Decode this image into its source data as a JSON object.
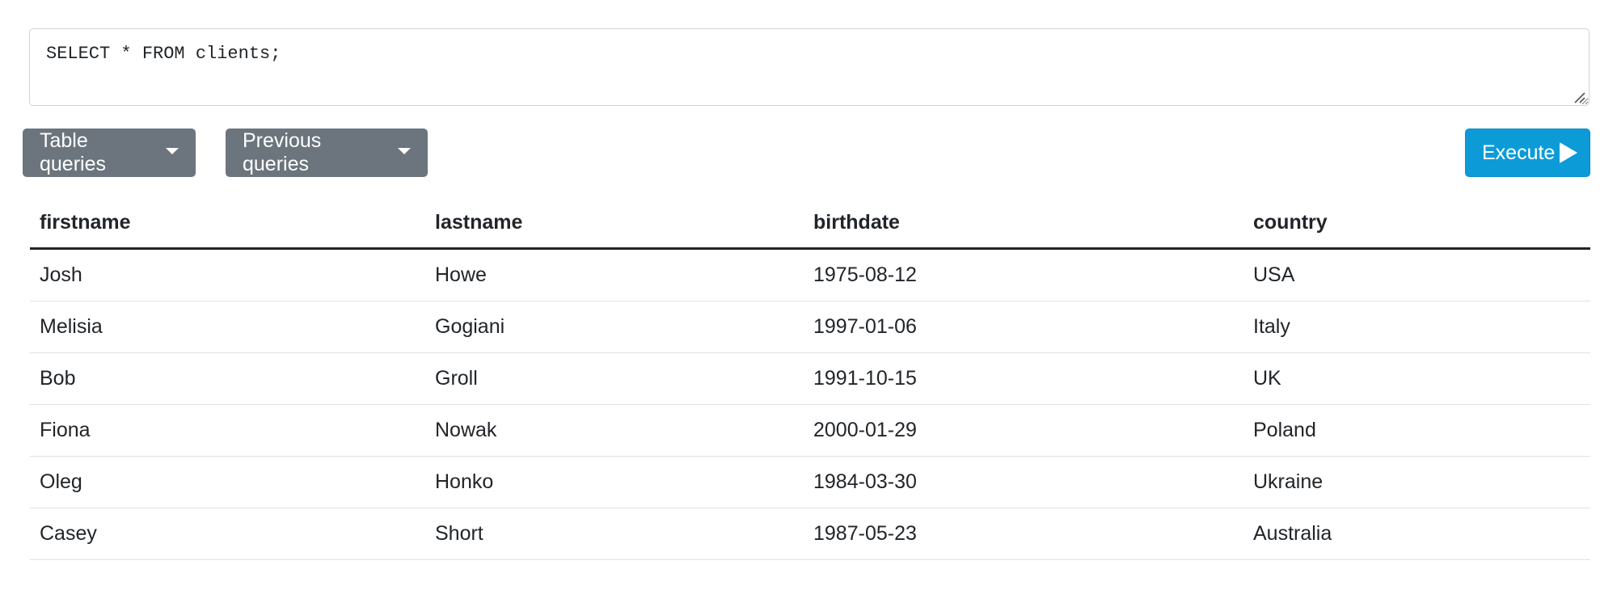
{
  "editor": {
    "query": "SELECT * FROM clients;"
  },
  "toolbar": {
    "table_queries_label": "Table queries",
    "previous_queries_label": "Previous queries",
    "execute_label": "Execute"
  },
  "colors": {
    "secondary_button": "#6c757d",
    "execute_button": "#0d9bd8",
    "text": "#212529"
  },
  "results": {
    "columns": [
      "firstname",
      "lastname",
      "birthdate",
      "country"
    ],
    "rows": [
      [
        "Josh",
        "Howe",
        "1975-08-12",
        "USA"
      ],
      [
        "Melisia",
        "Gogiani",
        "1997-01-06",
        "Italy"
      ],
      [
        "Bob",
        "Groll",
        "1991-10-15",
        "UK"
      ],
      [
        "Fiona",
        "Nowak",
        "2000-01-29",
        "Poland"
      ],
      [
        "Oleg",
        "Honko",
        "1984-03-30",
        "Ukraine"
      ],
      [
        "Casey",
        "Short",
        "1987-05-23",
        "Australia"
      ]
    ]
  }
}
